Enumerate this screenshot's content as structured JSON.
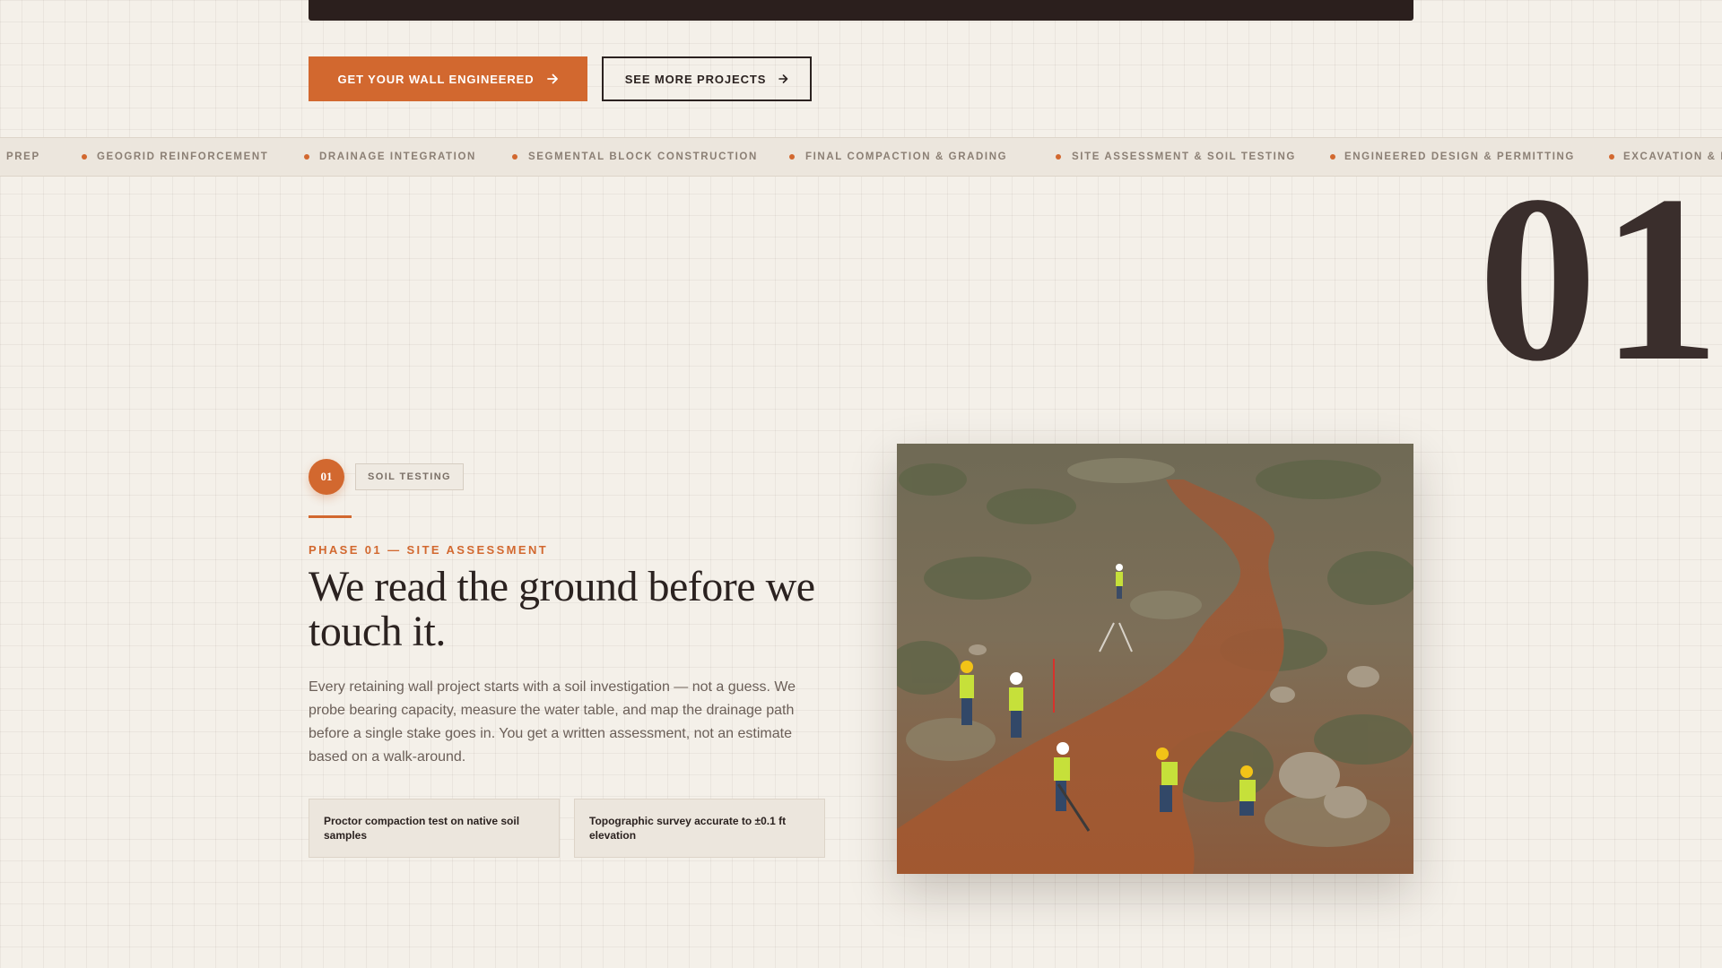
{
  "buttons": {
    "primary_label": "GET YOUR WALL ENGINEERED",
    "secondary_label": "SEE MORE PROJECTS"
  },
  "ticker": {
    "items": [
      "PREP",
      "GEOGRID REINFORCEMENT",
      "DRAINAGE INTEGRATION",
      "SEGMENTAL BLOCK CONSTRUCTION",
      "FINAL COMPACTION & GRADING",
      "SITE ASSESSMENT & SOIL TESTING",
      "ENGINEERED DESIGN & PERMITTING",
      "EXCAVATION & B"
    ]
  },
  "phase": {
    "big_number": "01",
    "step_number": "01",
    "tag": "SOIL TESTING",
    "eyebrow": "PHASE 01 — SITE ASSESSMENT",
    "headline": "We read the ground before we touch it.",
    "body": "Every retaining wall project starts with a soil investigation — not a guess. We probe bearing capacity, measure the water table, and map the drainage path before a single stake goes in. You get a written assessment, not an estimate based on a walk-around.",
    "facts": [
      "Proctor compaction test on native soil samples",
      "Topographic survey accurate to ±0.1 ft elevation"
    ]
  },
  "icons": {
    "arrow": "arrow-right-icon",
    "bullet": "dot-icon"
  },
  "colors": {
    "accent": "#d2682f",
    "dark": "#2b1f1d",
    "background": "#f4f0e9"
  }
}
